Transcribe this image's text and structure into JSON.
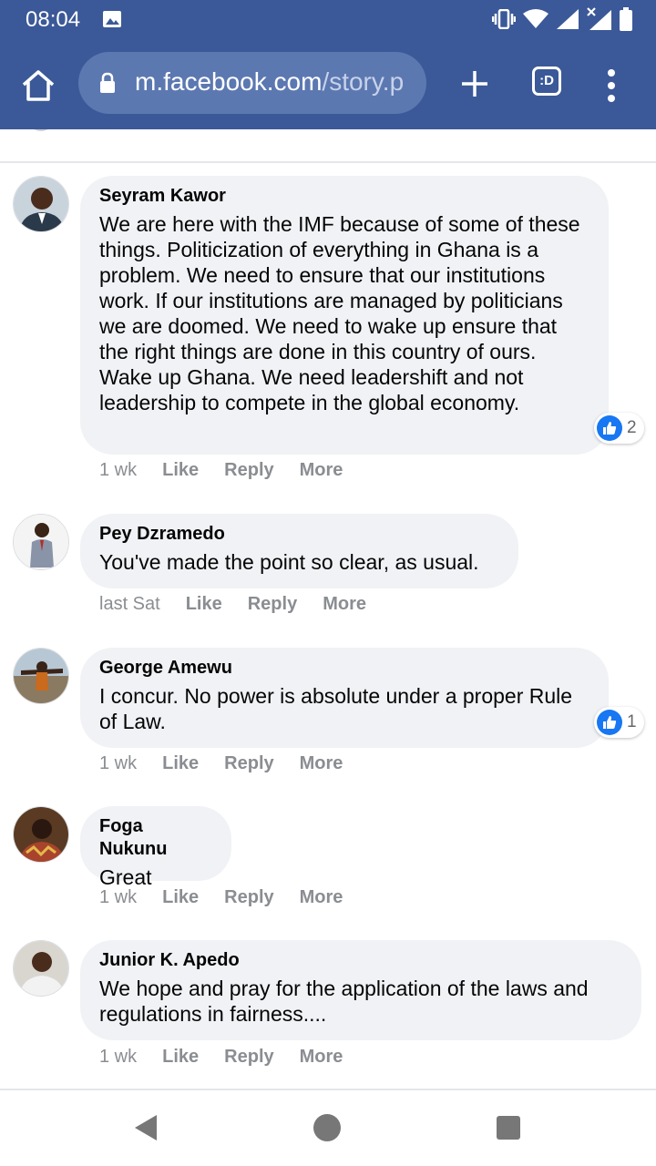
{
  "status_bar": {
    "time": "08:04"
  },
  "browser": {
    "url_domain": "m.facebook.com",
    "url_path": "/story.p",
    "tabs_label": ":D"
  },
  "comments": [
    {
      "author": "Seyram Kawor",
      "text": "We are here with the IMF because of some of these things. Politicization of everything in Ghana is a problem. We need to ensure that our institutions work. If our institutions are managed by politicians we are doomed. We need to wake up ensure that the right things are done in this country of ours. Wake up Ghana. We need leadershift and not leadership to compete in the global economy.",
      "time": "1 wk",
      "like_label": "Like",
      "reply_label": "Reply",
      "more_label": "More",
      "reaction_count": "2"
    },
    {
      "author": "Pey Dzramedo",
      "text": "You've made the point so clear, as usual.",
      "time": "last Sat",
      "like_label": "Like",
      "reply_label": "Reply",
      "more_label": "More"
    },
    {
      "author": "George Amewu",
      "text": "I concur. No power is absolute under a proper Rule of Law.",
      "time": "1 wk",
      "like_label": "Like",
      "reply_label": "Reply",
      "more_label": "More",
      "reaction_count": "1"
    },
    {
      "author": "Foga Nukunu",
      "text": "Great",
      "time": "1 wk",
      "like_label": "Like",
      "reply_label": "Reply",
      "more_label": "More"
    },
    {
      "author": "Junior K. Apedo",
      "text": "We hope and pray for the application of the laws and regulations in fairness....",
      "time": "1 wk",
      "like_label": "Like",
      "reply_label": "Reply",
      "more_label": "More"
    }
  ],
  "icons": {
    "status": [
      "image-icon",
      "vibrate-icon",
      "wifi-icon",
      "signal-icon",
      "signal-no-data-icon",
      "battery-icon"
    ],
    "browser": [
      "home-icon",
      "lock-icon",
      "new-tab-icon",
      "tab-switcher-icon",
      "more-menu-icon"
    ],
    "navigation": [
      "back-icon",
      "home-nav-icon",
      "recents-icon"
    ],
    "reaction": "like-reaction-icon"
  },
  "colors": {
    "chrome": "#3b5998",
    "urlbar": "#5c78b1",
    "bubble": "#f0f2f5",
    "like_blue": "#1877f2",
    "meta_text": "#8a8d91"
  }
}
